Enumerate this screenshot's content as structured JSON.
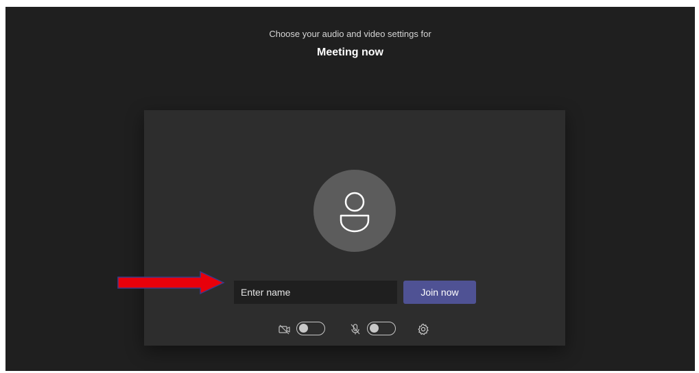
{
  "header": {
    "subtitle": "Choose your audio and video settings for",
    "meeting_title": "Meeting now"
  },
  "prejoin": {
    "name_input": {
      "placeholder": "Enter name",
      "value": ""
    },
    "join_label": "Join now",
    "controls": {
      "camera_icon": "camera-off-icon",
      "camera_on": false,
      "mic_icon": "mic-off-icon",
      "mic_on": false,
      "settings_icon": "gear-icon"
    }
  },
  "colors": {
    "background": "#1f1f1f",
    "panel": "#2d2d2d",
    "avatar": "#5c5c5c",
    "accent": "#4f5294",
    "annotation_arrow": "#e8000b"
  }
}
